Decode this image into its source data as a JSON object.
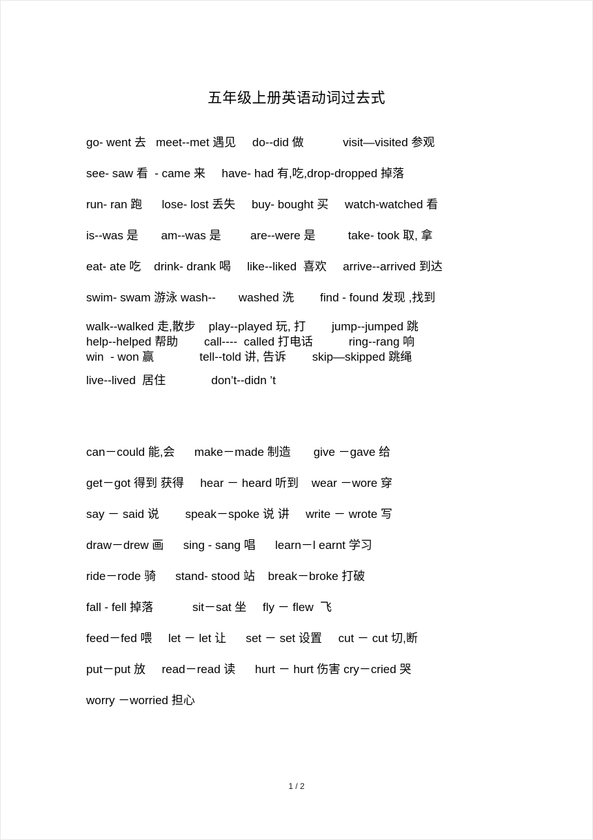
{
  "document": {
    "title": "五年级上册英语动词过去式",
    "footer_page_indicator": "1 / 2"
  },
  "section_one": {
    "lines": [
      "go- went 去   meet--met 遇见     do--did 做            visit—visited 参观",
      "see- saw 看  - came 来     have- had 有,吃,drop-dropped 掉落",
      "run- ran 跑      lose- lost 丢失     buy- bought 买     watch-watched 看",
      "is--was 是       am--was 是         are--were 是          take- took 取, 拿",
      "eat- ate 吃    drink- drank 喝     like--liked  喜欢     arrive--arrived 到达",
      "swim- swam 游泳 wash--       washed 洗        find - found 发现 ,找到",
      "walk--walked 走,散步    play--played 玩, 打        jump--jumped 跳",
      "help--helped 帮助        call----  called 打电话           ring--rang 响",
      "win  - won 赢              tell--told 讲, 告诉        skip—skipped 跳绳",
      "live--lived  居住              don’t--didn ’t"
    ]
  },
  "section_two": {
    "lines": [
      "can－could 能,会      make－made 制造       give －gave 给",
      "get－got 得到 获得     hear － heard 听到    wear －wore 穿",
      "say － said 说        speak－spoke 说 讲     write － wrote 写",
      "draw－drew 画      sing - sang 唱      learn－l earnt 学习",
      "ride－rode 骑      stand- stood 站    break－broke 打破",
      "fall - fell 掉落            sit－sat 坐     fly － flew  飞",
      "feed－fed 喂     let － let 让      set － set 设置     cut － cut 切,断",
      "put－put 放     read－read 读      hurt － hurt 伤害 cry－cried 哭",
      "worry －worried 担心"
    ]
  }
}
